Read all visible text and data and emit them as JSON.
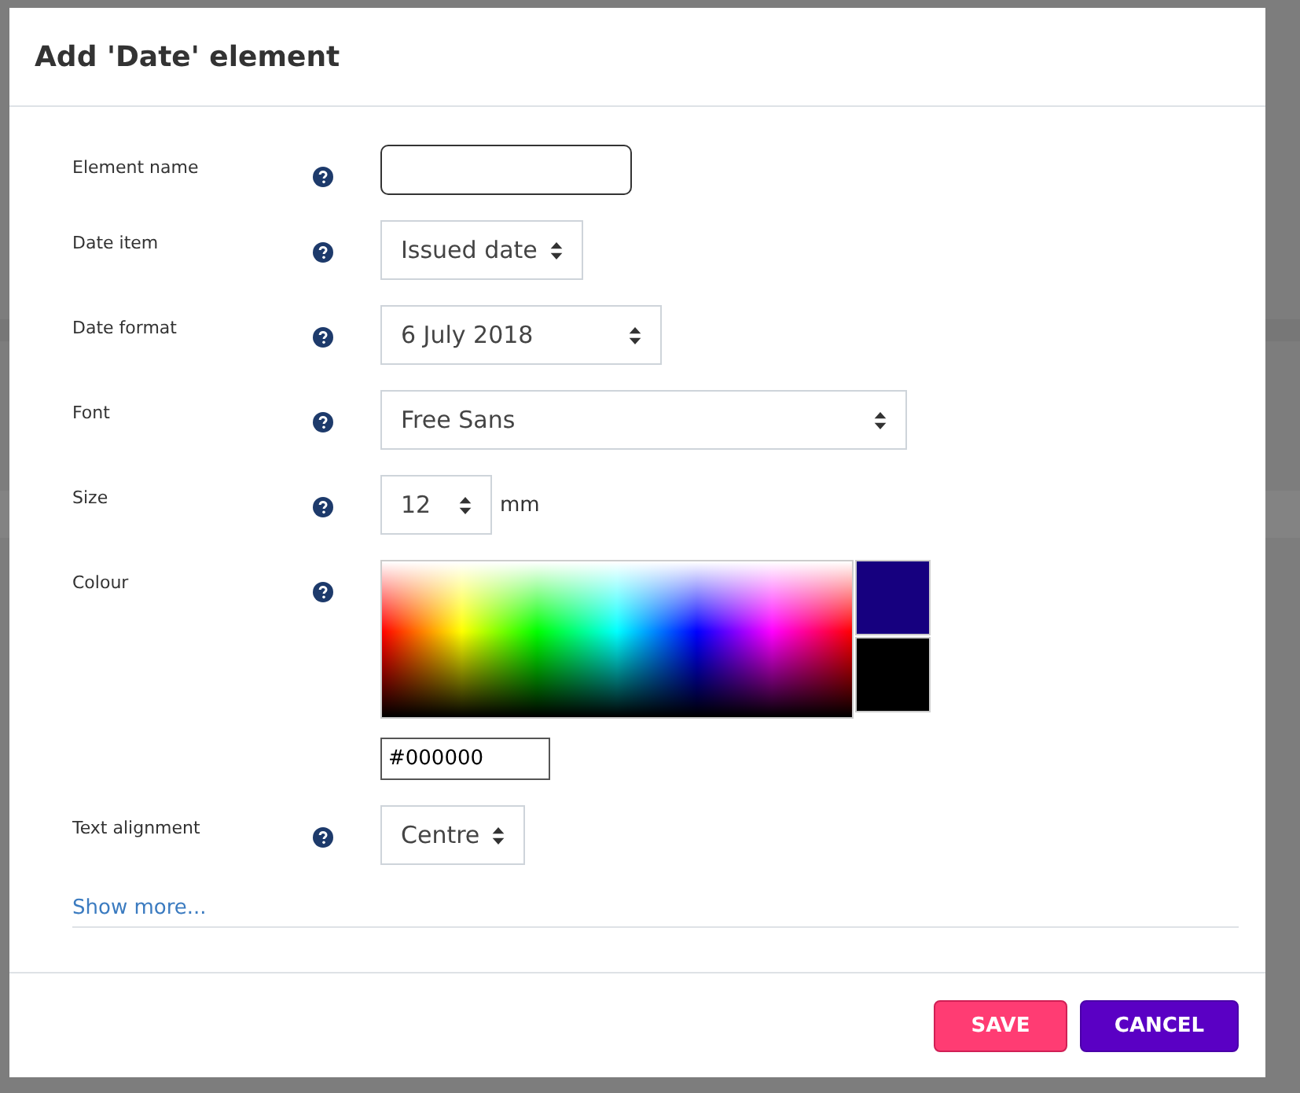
{
  "dialog": {
    "title": "Add 'Date' element"
  },
  "fields": [
    {
      "kind": "text",
      "label": "Element name"
    },
    {
      "kind": "select",
      "label": "Date item",
      "value": "Issued date"
    },
    {
      "kind": "select",
      "label": "Date format",
      "value": "6 July 2018"
    },
    {
      "kind": "select",
      "label": "Font",
      "value": "Free Sans"
    },
    {
      "kind": "select",
      "label": "Size",
      "value": "12",
      "unit": "mm"
    },
    {
      "kind": "colour",
      "label": "Colour",
      "value": "#000000",
      "swatches": [
        {
          "color": "#16007f"
        },
        {
          "color": "#000000"
        }
      ]
    },
    {
      "kind": "select",
      "label": "Text alignment",
      "value": "Centre"
    }
  ],
  "show_more": "Show more...",
  "buttons": [
    {
      "label": "SAVE",
      "kind": "primary"
    },
    {
      "label": "CANCEL",
      "kind": "secondary"
    }
  ]
}
